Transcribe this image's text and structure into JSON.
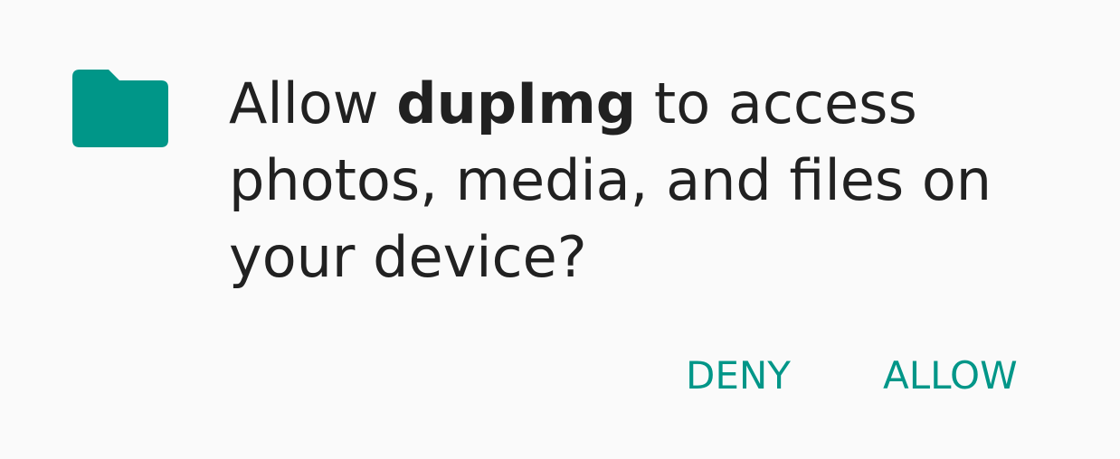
{
  "dialog": {
    "icon": "folder-icon",
    "message_prefix": "Allow ",
    "app_name": "dupImg",
    "message_suffix": " to access photos, media, and files on your device?",
    "deny_label": "DENY",
    "allow_label": "ALLOW"
  },
  "colors": {
    "accent": "#009688",
    "text": "#212121",
    "background": "#fafafa"
  }
}
